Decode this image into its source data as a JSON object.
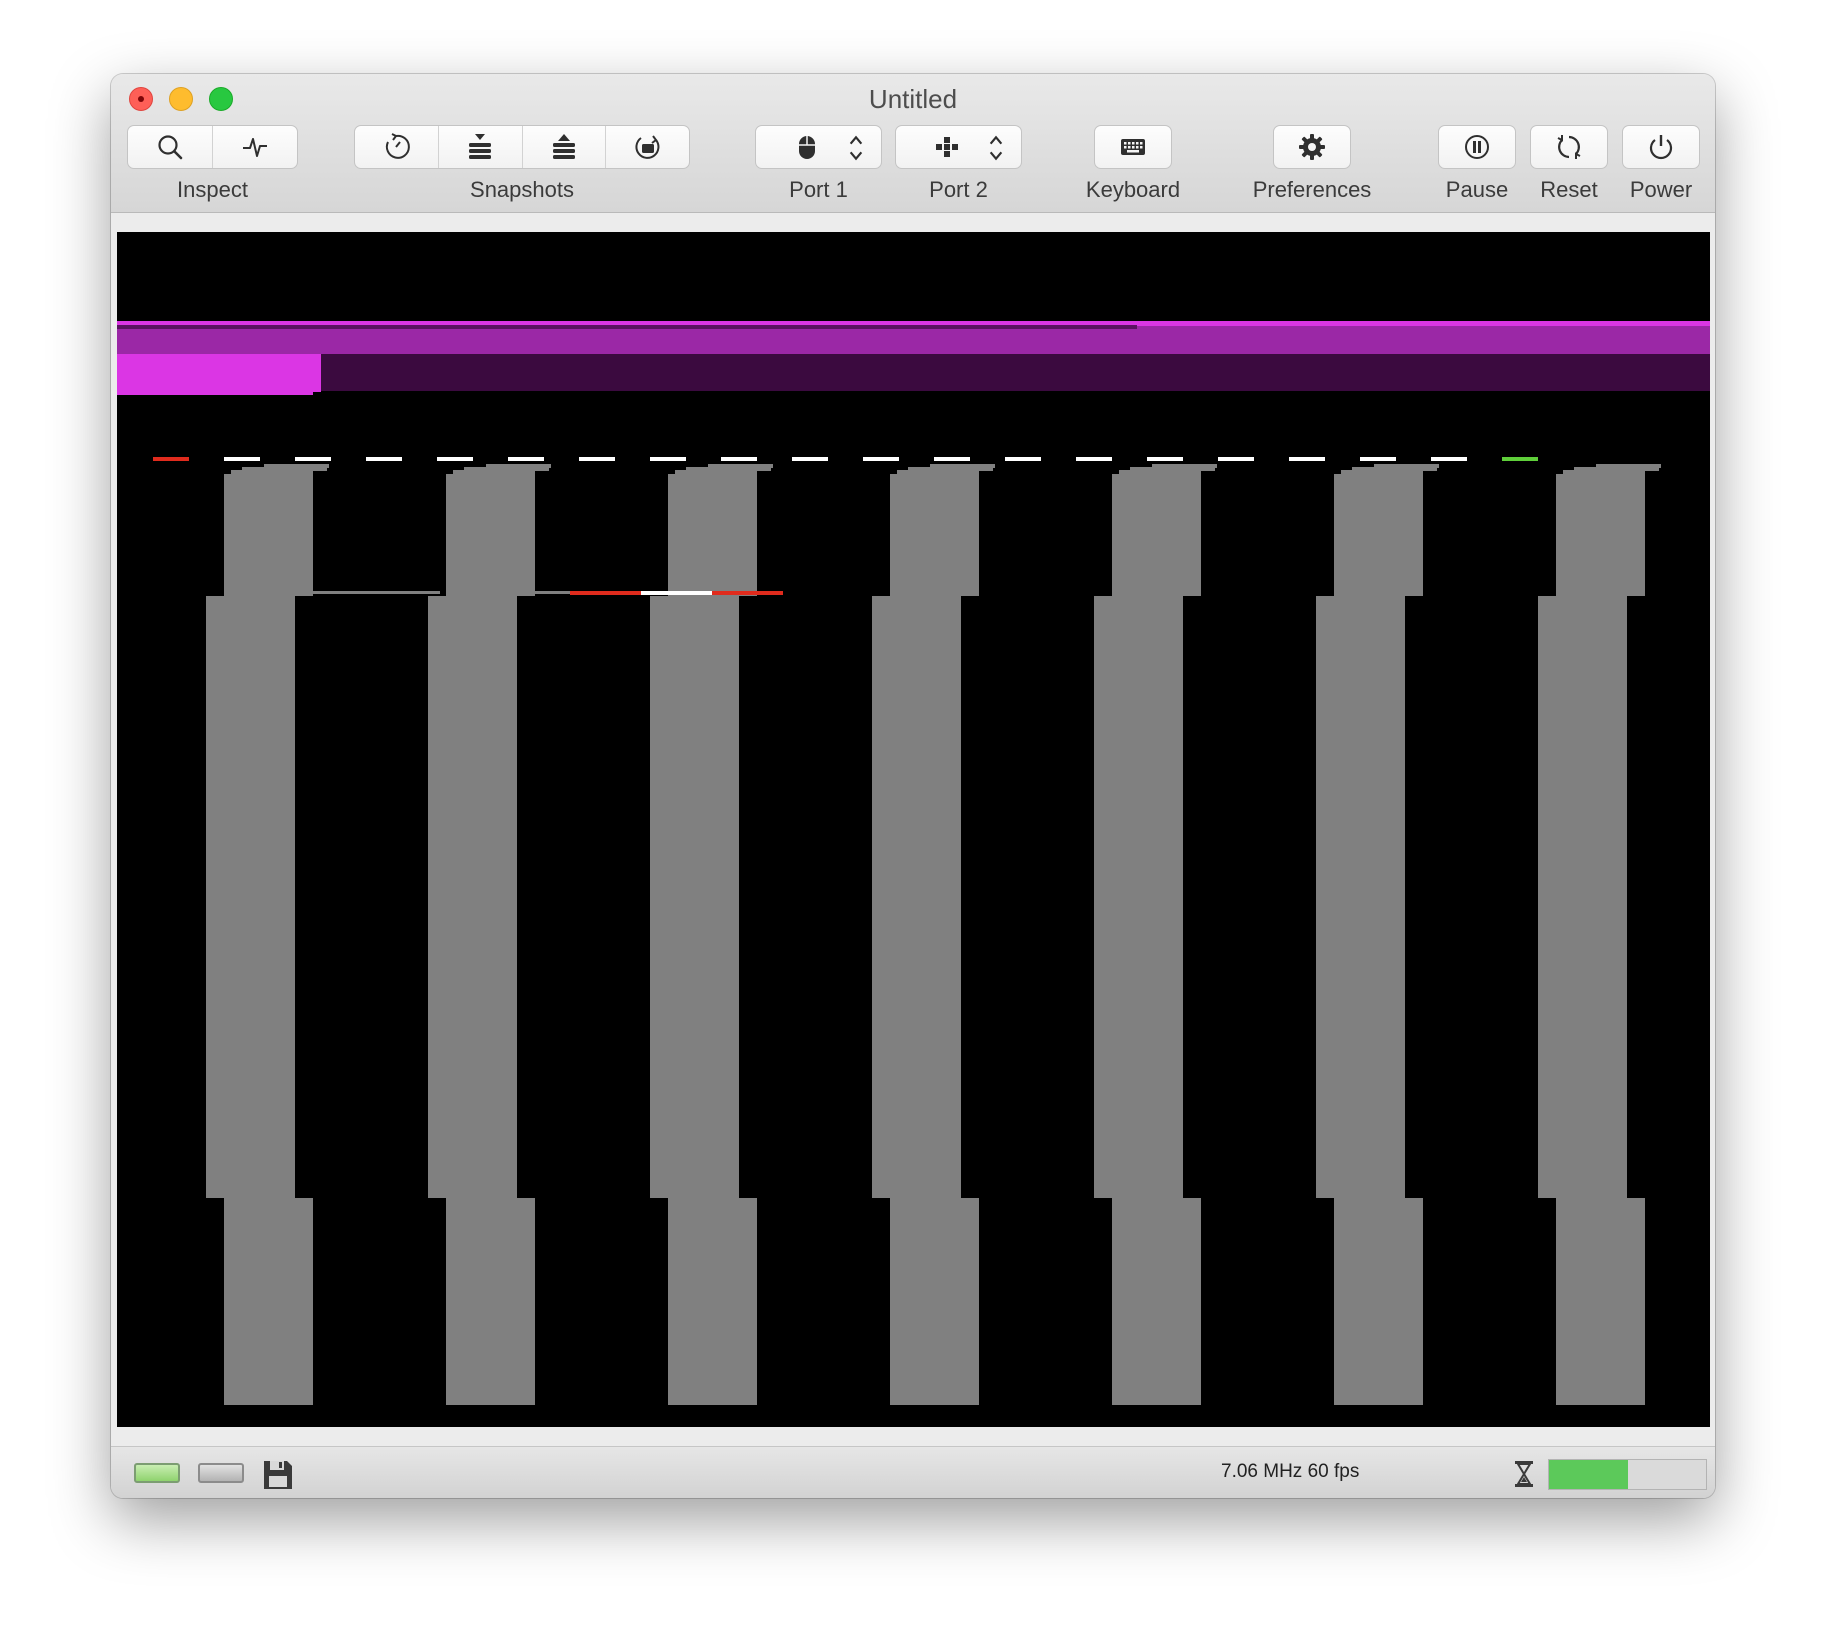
{
  "window": {
    "title": "Untitled"
  },
  "toolbar": {
    "inspect_label": "Inspect",
    "snapshots_label": "Snapshots",
    "port1_label": "Port 1",
    "port2_label": "Port 2",
    "keyboard_label": "Keyboard",
    "preferences_label": "Preferences",
    "pause_label": "Pause",
    "reset_label": "Reset",
    "power_label": "Power",
    "icons": {
      "inspect": [
        "magnifier-icon",
        "activity-monitor-icon"
      ],
      "snapshots": [
        "auto-snapshot-icon",
        "take-snapshot-icon",
        "restore-snapshot-icon",
        "browse-snapshots-icon"
      ],
      "port1": "mouse-icon",
      "port2": "joystick-icon",
      "keyboard": "keyboard-icon",
      "preferences": "gear-icon",
      "pause": "pause-icon",
      "reset": "reset-icon",
      "power": "power-icon"
    }
  },
  "statusbar": {
    "speed_text": "7.06 MHz 60 fps",
    "drive_icons": [
      "drive-df0-icon",
      "drive-df1-icon"
    ],
    "disk_icon": "floppy-disk-icon",
    "activity_icon": "hourglass-icon",
    "activity_level": 0.5
  },
  "colors": {
    "screen_background": "#000000",
    "bar_gray": "#808080",
    "magenta_bright": "#db36e4",
    "magenta_mid": "#9b28a6",
    "magenta_dark": "#3b0a3f",
    "marker_white": "#ffffff",
    "marker_red": "#e02b1d",
    "marker_green": "#5fcf3a",
    "activity_green": "#5cc95a"
  }
}
